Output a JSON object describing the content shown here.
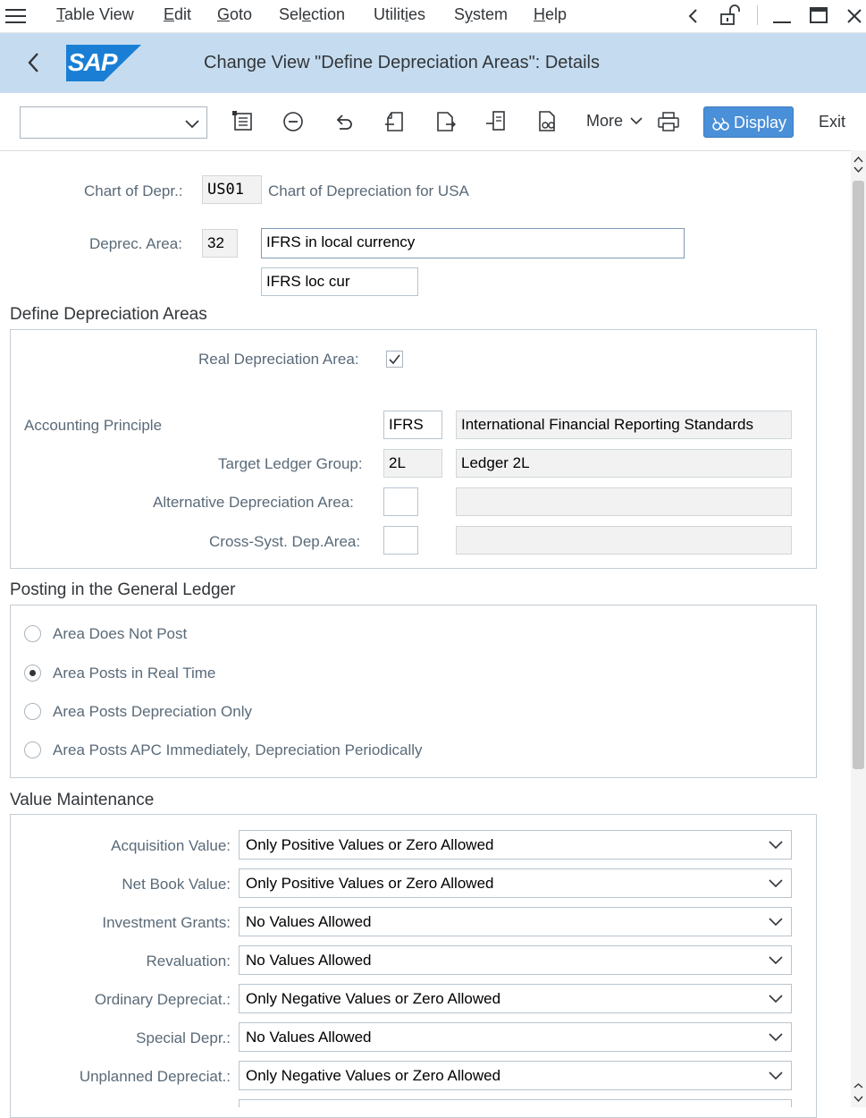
{
  "menu": [
    {
      "pre": "",
      "u": "T",
      "post": "able View"
    },
    {
      "pre": "",
      "u": "E",
      "post": "dit"
    },
    {
      "pre": "",
      "u": "G",
      "post": "oto"
    },
    {
      "pre": "Sel",
      "u": "e",
      "post": "ction"
    },
    {
      "pre": "Utilit",
      "u": "i",
      "post": "es"
    },
    {
      "pre": "S",
      "u": "y",
      "post": "stem"
    },
    {
      "pre": "",
      "u": "H",
      "post": "elp"
    }
  ],
  "title": "Change View \"Define Depreciation Areas\": Details",
  "logo_text": "SAP",
  "toolbar": {
    "more_label": "More",
    "display_label": "Display",
    "exit_label": "Exit",
    "combo_value": ""
  },
  "header": {
    "chart_label": "Chart of Depr.:",
    "chart_value": "US01",
    "chart_desc": "Chart of Depreciation for USA",
    "area_label": "Deprec. Area:",
    "area_value": "32",
    "area_name": "IFRS in local currency",
    "area_short": "IFRS loc cur"
  },
  "define": {
    "title": "Define Depreciation Areas",
    "real_label": "Real Depreciation Area:",
    "real_checked": true,
    "acc_label": "Accounting Principle",
    "acc_value": "IFRS",
    "acc_desc": "International Financial Reporting Standards",
    "ledger_label": "Target Ledger Group:",
    "ledger_value": "2L",
    "ledger_desc": "Ledger 2L",
    "alt_label": "Alternative Depreciation Area:",
    "alt_value": "",
    "alt_desc": "",
    "cross_label": "Cross-Syst. Dep.Area:",
    "cross_value": "",
    "cross_desc": ""
  },
  "posting": {
    "title": "Posting in the General Ledger",
    "options": [
      {
        "label": "Area Does Not Post",
        "selected": false
      },
      {
        "label": "Area Posts in Real Time",
        "selected": true
      },
      {
        "label": "Area Posts Depreciation Only",
        "selected": false
      },
      {
        "label": "Area Posts APC Immediately, Depreciation Periodically",
        "selected": false
      }
    ]
  },
  "value_maintenance": {
    "title": "Value Maintenance",
    "rows": [
      {
        "label": "Acquisition Value:",
        "value": "Only Positive Values or Zero Allowed"
      },
      {
        "label": "Net Book Value:",
        "value": "Only Positive Values or Zero Allowed"
      },
      {
        "label": "Investment Grants:",
        "value": "No Values Allowed"
      },
      {
        "label": "Revaluation:",
        "value": "No Values Allowed"
      },
      {
        "label": "Ordinary Depreciat.:",
        "value": "Only Negative Values or Zero Allowed"
      },
      {
        "label": "Special Depr.:",
        "value": "No Values Allowed"
      },
      {
        "label": "Unplanned Depreciat.:",
        "value": "Only Negative Values or Zero Allowed"
      }
    ]
  },
  "colors": {
    "title_bar": "#c5dcf0",
    "display_button": "#4a90d9",
    "sap_logo": "#1a7fd4"
  }
}
